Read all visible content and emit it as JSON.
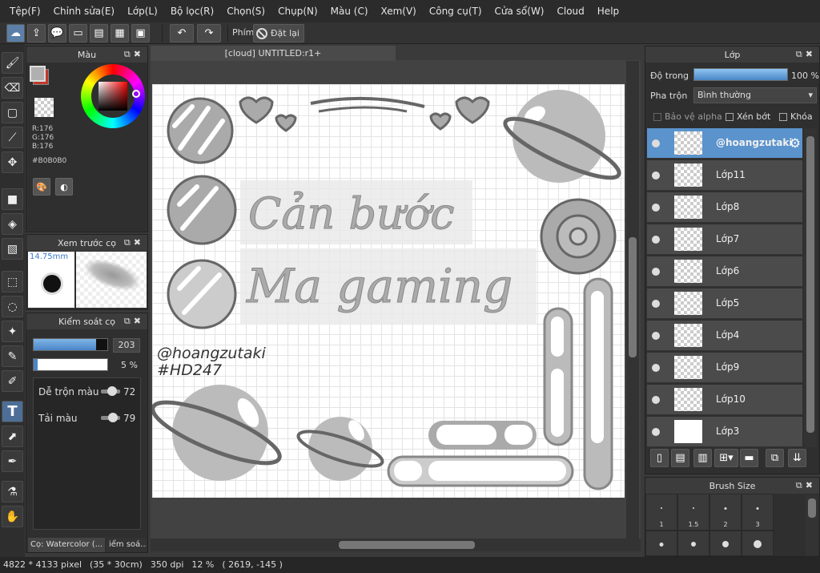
{
  "menu": [
    "Tệp(F)",
    "Chỉnh sửa(E)",
    "Lớp(L)",
    "Bộ lọc(R)",
    "Chọn(S)",
    "Chụp(N)",
    "Màu (C)",
    "Xem(V)",
    "Công cụ(T)",
    "Cửa sổ(W)",
    "Cloud",
    "Help"
  ],
  "toolbar": {
    "shortcut_label": "Phím",
    "reset_label": "Đặt lại"
  },
  "color_panel": {
    "title": "Màu",
    "r": "R:176",
    "g": "G:176",
    "b": "B:176",
    "hex": "#B0B0B0",
    "main_color": "#b0b0b0",
    "accent_color": "#c0392b"
  },
  "brush_preview": {
    "title": "Xem trước cọ",
    "size": "14.75mm"
  },
  "brush_control": {
    "title": "Kiểm soát cọ",
    "size_value": "203",
    "size_fill": 0.85,
    "opacity_value": "5 %",
    "opacity_fill": 0.05,
    "blend_label": "Dễ trộn màu",
    "blend_value": "72",
    "load_label": "Tải màu",
    "load_value": "79",
    "brush_tab": "Cọ: Watercolor (...",
    "control_tab": "iểm soá..."
  },
  "document": {
    "tab": "[cloud] UNTITLED:r1+",
    "watermark_line1": "@hoangzutaki",
    "watermark_line2": "#HD247",
    "title_line1": "Cản bước",
    "title_line2": "Ma gaming"
  },
  "layer_panel": {
    "title": "Lớp",
    "opacity_label": "Độ trong",
    "opacity_value": "100 %",
    "blend_label": "Pha trộn",
    "blend_value": "Bình thường",
    "protect_alpha": "Bảo vệ alpha",
    "clip": "Xén bớt",
    "lock": "Khóa",
    "layers": [
      {
        "name": "@hoangzutaki"
      },
      {
        "name": "Lớp11"
      },
      {
        "name": "Lớp8"
      },
      {
        "name": "Lớp7"
      },
      {
        "name": "Lớp6"
      },
      {
        "name": "Lớp5"
      },
      {
        "name": "Lớp4"
      },
      {
        "name": "Lớp9"
      },
      {
        "name": "Lớp10"
      },
      {
        "name": "Lớp3"
      }
    ]
  },
  "brush_size_panel": {
    "title": "Brush Size",
    "sizes": [
      "1",
      "1.5",
      "2",
      "3"
    ]
  },
  "status": {
    "size": "4822 * 4133 pixel",
    "cm": "(35 * 30cm)",
    "dpi": "350 dpi",
    "zoom": "12 %",
    "coords": "( 2619, -145 )"
  }
}
